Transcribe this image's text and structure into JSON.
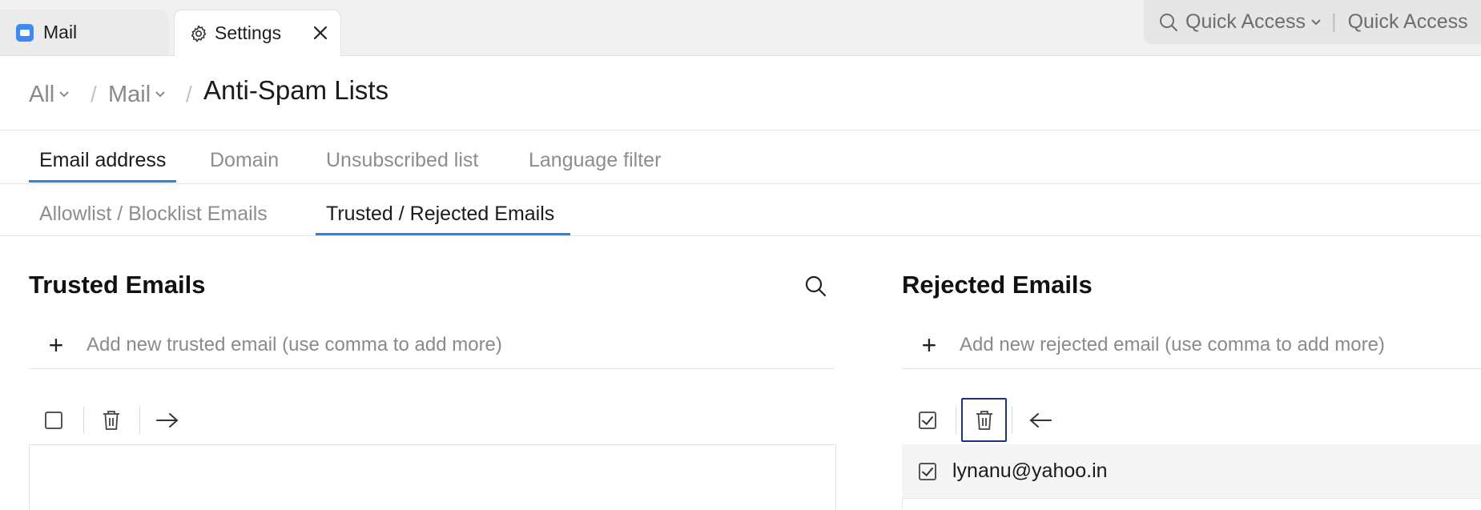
{
  "tabs": [
    {
      "label": "Mail",
      "icon": "mail-app-icon"
    },
    {
      "label": "Settings",
      "icon": "gear-icon"
    }
  ],
  "quick_access": {
    "label": "Quick Access",
    "label_right": "Quick Access",
    "separator": "|"
  },
  "breadcrumb": {
    "all": "All",
    "mail": "Mail",
    "separator": "/",
    "title": "Anti-Spam Lists"
  },
  "primary_tabs": [
    "Email address",
    "Domain",
    "Unsubscribed list",
    "Language filter"
  ],
  "secondary_tabs": [
    "Allowlist / Blocklist Emails",
    "Trusted / Rejected Emails"
  ],
  "trusted": {
    "title": "Trusted Emails",
    "add_placeholder": "Add new trusted email (use comma to add more)",
    "plus": "+"
  },
  "rejected": {
    "title": "Rejected Emails",
    "add_placeholder": "Add new rejected email (use comma to add more)",
    "plus": "+",
    "emails": [
      "lynanu@yahoo.in"
    ]
  },
  "colors": {
    "accent": "#2b86d9",
    "focus": "#1d3580",
    "mail_icon": "#3d8bf2"
  }
}
